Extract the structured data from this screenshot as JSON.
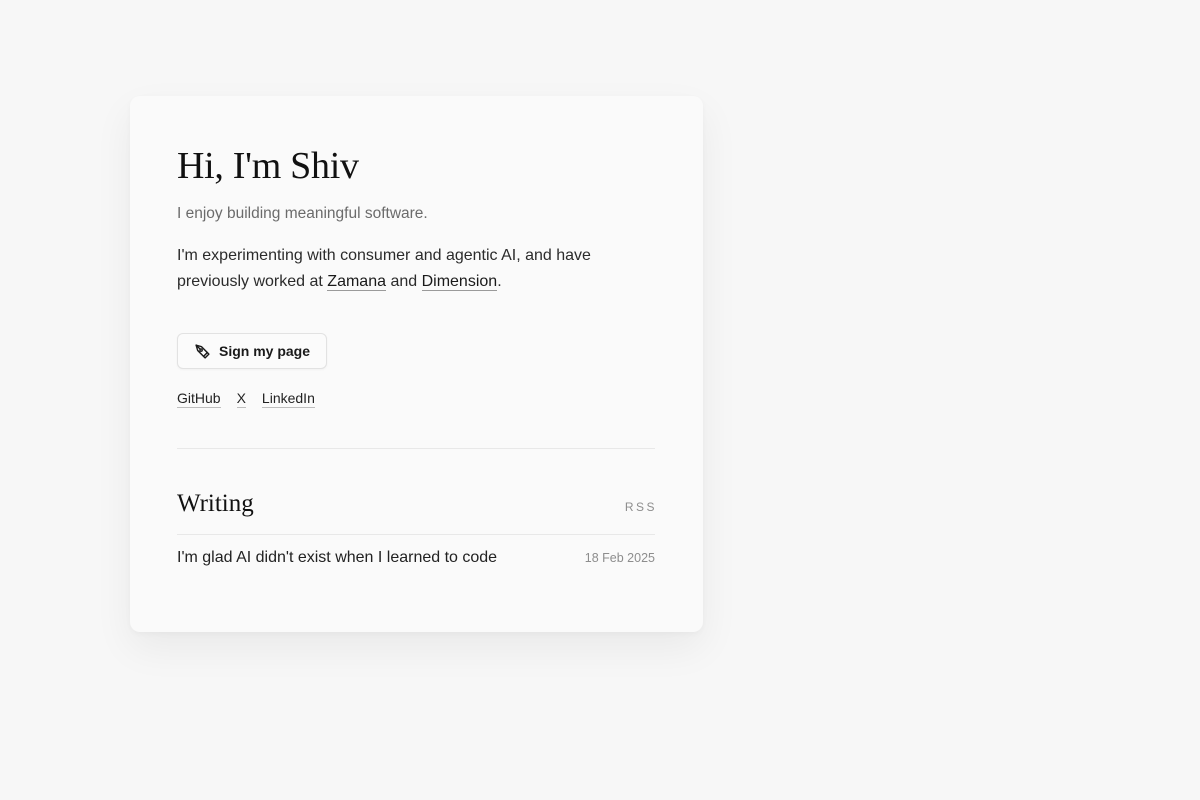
{
  "hero": {
    "title": "Hi, I'm Shiv",
    "tagline": "I enjoy building meaningful software.",
    "bio_prefix": "I'm experimenting with consumer and agentic AI, and have previously worked at ",
    "bio_link_1": "Zamana",
    "bio_mid": " and ",
    "bio_link_2": "Dimension",
    "bio_suffix": "."
  },
  "sign_button": {
    "label": "Sign my page",
    "icon": "pen-nib-icon"
  },
  "social": [
    {
      "label": "GitHub"
    },
    {
      "label": "X"
    },
    {
      "label": "LinkedIn"
    }
  ],
  "writing": {
    "title": "Writing",
    "rss_label": "RSS",
    "posts": [
      {
        "title": "I'm glad AI didn't exist when I learned to code",
        "date": "18 Feb 2025"
      }
    ]
  }
}
